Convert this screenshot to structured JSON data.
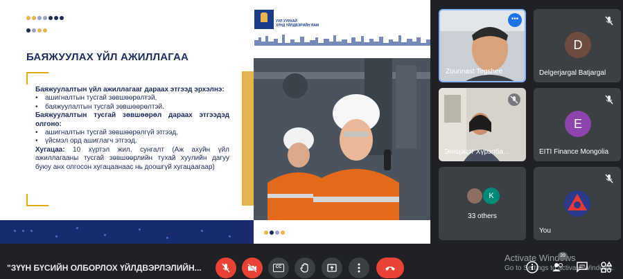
{
  "slide": {
    "title": "БАЯЖУУЛАХ ҮЙЛ АЖИЛЛАГАА",
    "logo_text_1": "УУЛ УУРХАЙ",
    "logo_text_2": "ХҮНД ҮЙЛДВЭРИЙН ЯАМ",
    "heading_1": "Баяжуулалтын үйл ажиллагааг дараах этгээд эрхэлнэ:",
    "bullets_1": [
      "ашигналтын тусгай зөвшөөрөлтэй,",
      "баяжуулалтын тусгай зөвшөөрөлтэй."
    ],
    "heading_2": "Баяжуулалтын тусгай зөвшөөрөл дараах этгээдэд олгоно:",
    "bullets_2": [
      "ашигналтын тусгай зөвшөөрөлгүй этгээд,",
      "үйсмэл орд ашиглагч этгээд."
    ],
    "term_label": "Хугацаа:",
    "term_text": " 10 хүртэл жил, сунгалт (Аж ахуйн үйл ажиллагааны тусгай зөвшөөрлийн тухай хуулийн дагуу буюу анх олгосон хугацаанаас нь доошгүй хугацаагаар)"
  },
  "participants": [
    {
      "name": "Zuunnast Tegshee",
      "type": "video"
    },
    {
      "name": "Delgerjargal Batjargal",
      "initial": "D",
      "color": "#6d4c41"
    },
    {
      "name": "Энхцэцэг Хүрэлба...",
      "type": "video"
    },
    {
      "name": "EITI Finance Mongolia",
      "initial": "E",
      "color": "#8e44ad"
    },
    {
      "name": "33 others",
      "initial_small": "K"
    },
    {
      "name": "You"
    }
  ],
  "meeting": {
    "title": "\"ЗҮҮН БҮСИЙН ОЛБОРЛОХ ҮЙЛДВЭРЛЭЛИЙН...",
    "captions_label": "CC",
    "people_count": "39"
  },
  "watermark": {
    "line1": "Activate Windows",
    "line2": "Go to Settings to activate Windows."
  },
  "colors": {
    "accent_gold": "#e6b34c",
    "navy": "#1c2b5a",
    "end_call_red": "#ea4335"
  }
}
